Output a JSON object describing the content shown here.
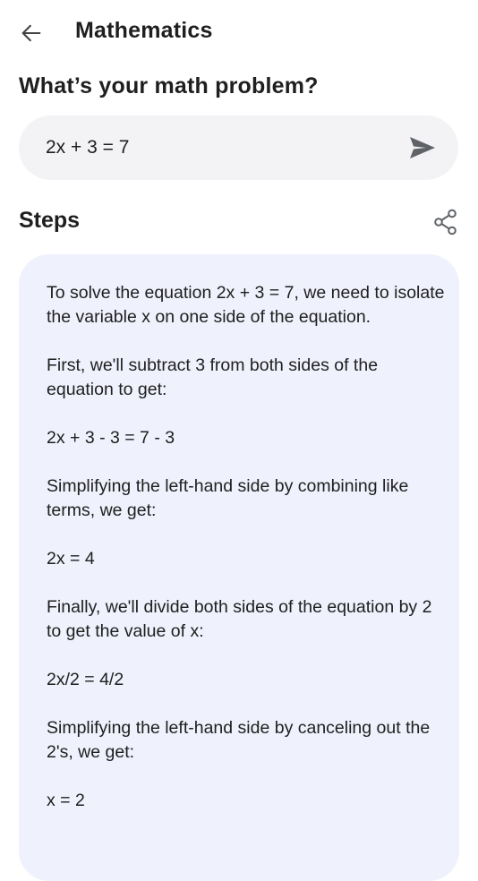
{
  "header": {
    "title": "Mathematics",
    "back_icon": "arrow-left-icon"
  },
  "prompt": {
    "heading": "What’s your math problem?",
    "input_value": "2x + 3 = 7",
    "send_icon": "send-icon"
  },
  "steps": {
    "heading": "Steps",
    "share_icon": "share-icon",
    "paragraphs": [
      "To solve the equation 2x + 3 = 7, we need to isolate the variable x on one side of the equation.",
      "First, we'll subtract 3 from both sides of the equation to get:",
      "2x + 3 - 3 = 7 - 3",
      "Simplifying the left-hand side by combining like terms, we get:",
      "2x = 4",
      "Finally, we'll divide both sides of the equation by 2 to get the value of x:",
      "2x/2 = 4/2",
      "Simplifying the left-hand side by canceling out the 2's, we get:",
      "x = 2"
    ]
  },
  "colors": {
    "input_background": "#f3f3f6",
    "card_background": "#eff1fc",
    "icon_gray": "#5f6368",
    "text": "#1f1f1f"
  }
}
